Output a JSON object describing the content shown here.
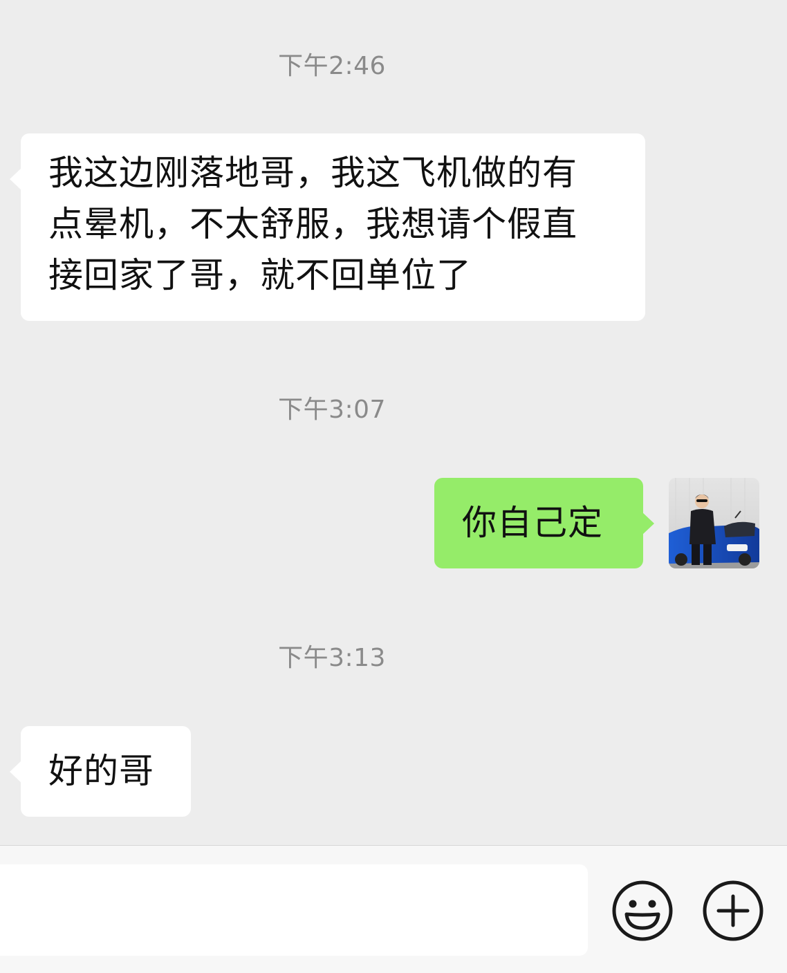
{
  "messages": [
    {
      "type": "timestamp",
      "text": "下午2:46"
    },
    {
      "type": "incoming",
      "lines": [
        "我这边刚落地哥，我这飞机做的有",
        "点晕机，不太舒服，我想请个假直",
        "接回家了哥，就不回单位了"
      ]
    },
    {
      "type": "timestamp",
      "text": "下午3:07"
    },
    {
      "type": "outgoing",
      "text": "你自己定"
    },
    {
      "type": "timestamp",
      "text": "下午3:13"
    },
    {
      "type": "incoming",
      "text": "好的哥"
    }
  ],
  "colors": {
    "background": "#ededed",
    "incoming_bubble": "#ffffff",
    "outgoing_bubble": "#95ec69",
    "timestamp": "#8a8a8a"
  },
  "input_bar": {
    "input_value": "",
    "icons": [
      "emoji-icon",
      "plus-icon"
    ]
  },
  "avatar": {
    "icon": "user-avatar-photo"
  }
}
